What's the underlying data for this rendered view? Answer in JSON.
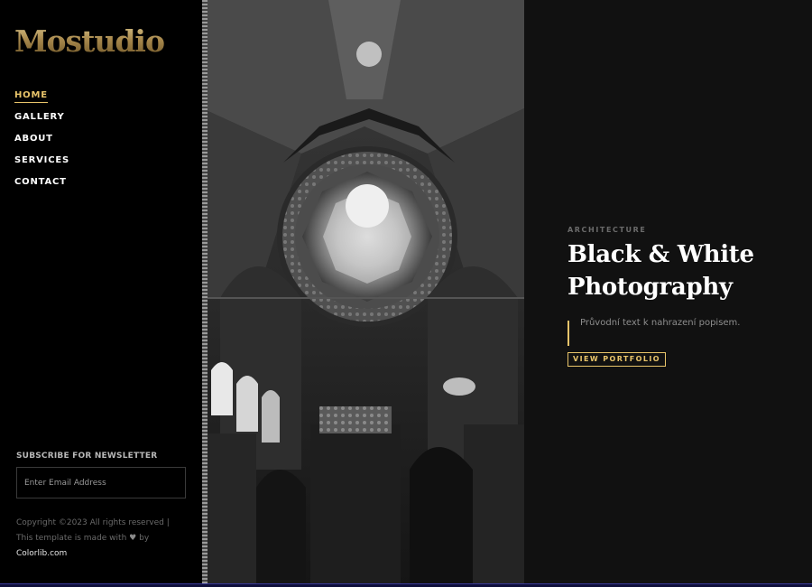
{
  "brand": {
    "logo_text": "Mostudio"
  },
  "nav": {
    "items": [
      {
        "label": "HOME",
        "active": true
      },
      {
        "label": "GALLERY",
        "active": false
      },
      {
        "label": "ABOUT",
        "active": false
      },
      {
        "label": "SERVICES",
        "active": false
      },
      {
        "label": "CONTACT",
        "active": false
      }
    ]
  },
  "newsletter": {
    "title": "SUBSCRIBE FOR NEWSLETTER",
    "placeholder": "Enter Email Address"
  },
  "footer": {
    "copyright_text": "Copyright ©2023 All rights reserved | This template is made with",
    "heart_icon": "heart-icon",
    "by_text": "by",
    "credit_link": "Colorlib.com"
  },
  "hero": {
    "category": "ARCHITECTURE",
    "title": "Black & White Photography",
    "description": "Průvodní text k nahrazení popisem.",
    "button_label": "VIEW PORTFOLIO",
    "image_subject": "black-and-white cathedral dome interior"
  },
  "colors": {
    "accent": "#e8c46a",
    "sidebar_bg": "#000000",
    "content_bg": "#111111"
  }
}
